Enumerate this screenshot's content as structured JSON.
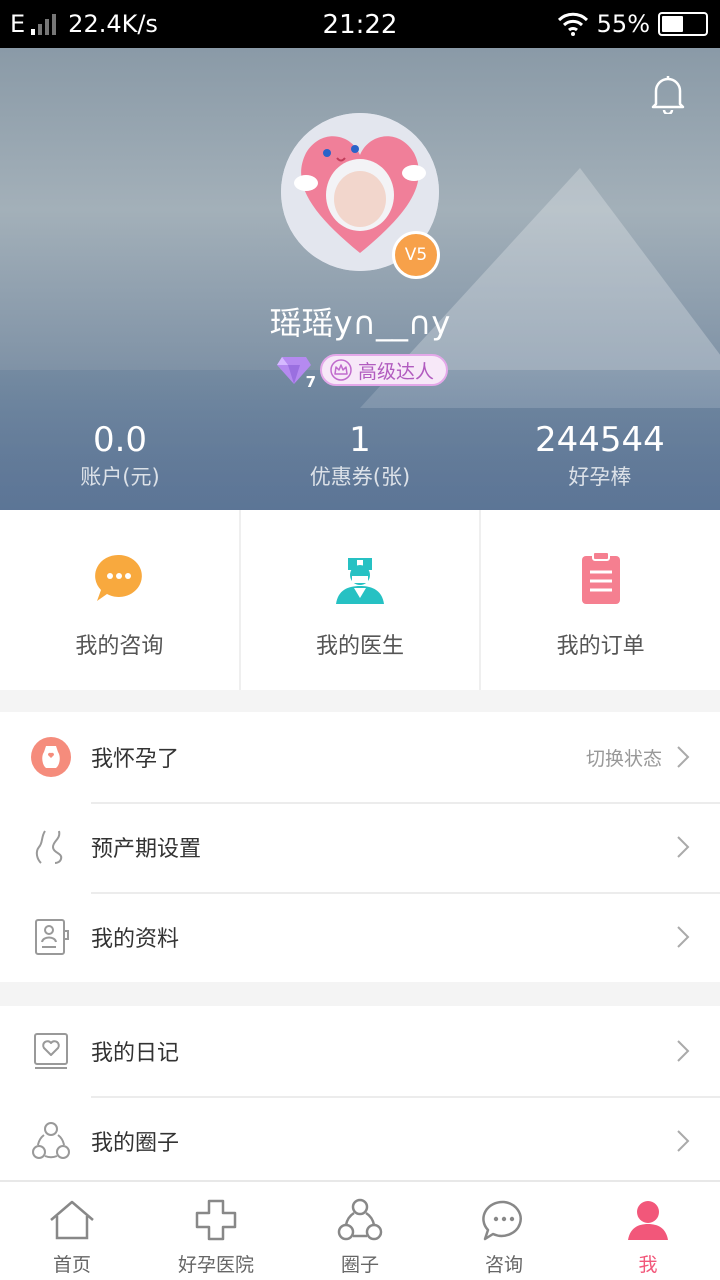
{
  "status_bar": {
    "network_type": "E",
    "speed": "22.4K/s",
    "time": "21:22",
    "battery_pct": "55%",
    "battery_level": 0.55
  },
  "profile": {
    "username": "瑶瑶y∩__∩y",
    "vip_badge": "V5",
    "diamond_level": "7",
    "rank_label": "高级达人",
    "stats": [
      {
        "value": "0.0",
        "label": "账户(元)"
      },
      {
        "value": "1",
        "label": "优惠券(张)"
      },
      {
        "value": "244544",
        "label": "好孕棒"
      }
    ]
  },
  "quick_actions": [
    {
      "label": "我的咨询",
      "icon": "chat-bubble-icon",
      "color": "#f8a93e"
    },
    {
      "label": "我的医生",
      "icon": "doctor-icon",
      "color": "#26c1c3"
    },
    {
      "label": "我的订单",
      "icon": "clipboard-icon",
      "color": "#f57f90"
    }
  ],
  "menu_group_1": [
    {
      "label": "我怀孕了",
      "extra": "切换状态",
      "icon": "pregnant-icon"
    },
    {
      "label": "预产期设置",
      "extra": "",
      "icon": "belly-icon"
    },
    {
      "label": "我的资料",
      "extra": "",
      "icon": "profile-card-icon"
    }
  ],
  "menu_group_2": [
    {
      "label": "我的日记",
      "icon": "diary-icon"
    },
    {
      "label": "我的圈子",
      "icon": "circle-icon"
    }
  ],
  "tabs": [
    {
      "label": "首页",
      "icon": "home-icon"
    },
    {
      "label": "好孕医院",
      "icon": "hospital-cross-icon"
    },
    {
      "label": "圈子",
      "icon": "circle-group-icon"
    },
    {
      "label": "咨询",
      "icon": "chat-icon"
    },
    {
      "label": "我",
      "icon": "person-icon",
      "active": true
    }
  ],
  "colors": {
    "accent": "#f2577a",
    "vip": "#f7a14a",
    "rank": "#b15bbf"
  }
}
